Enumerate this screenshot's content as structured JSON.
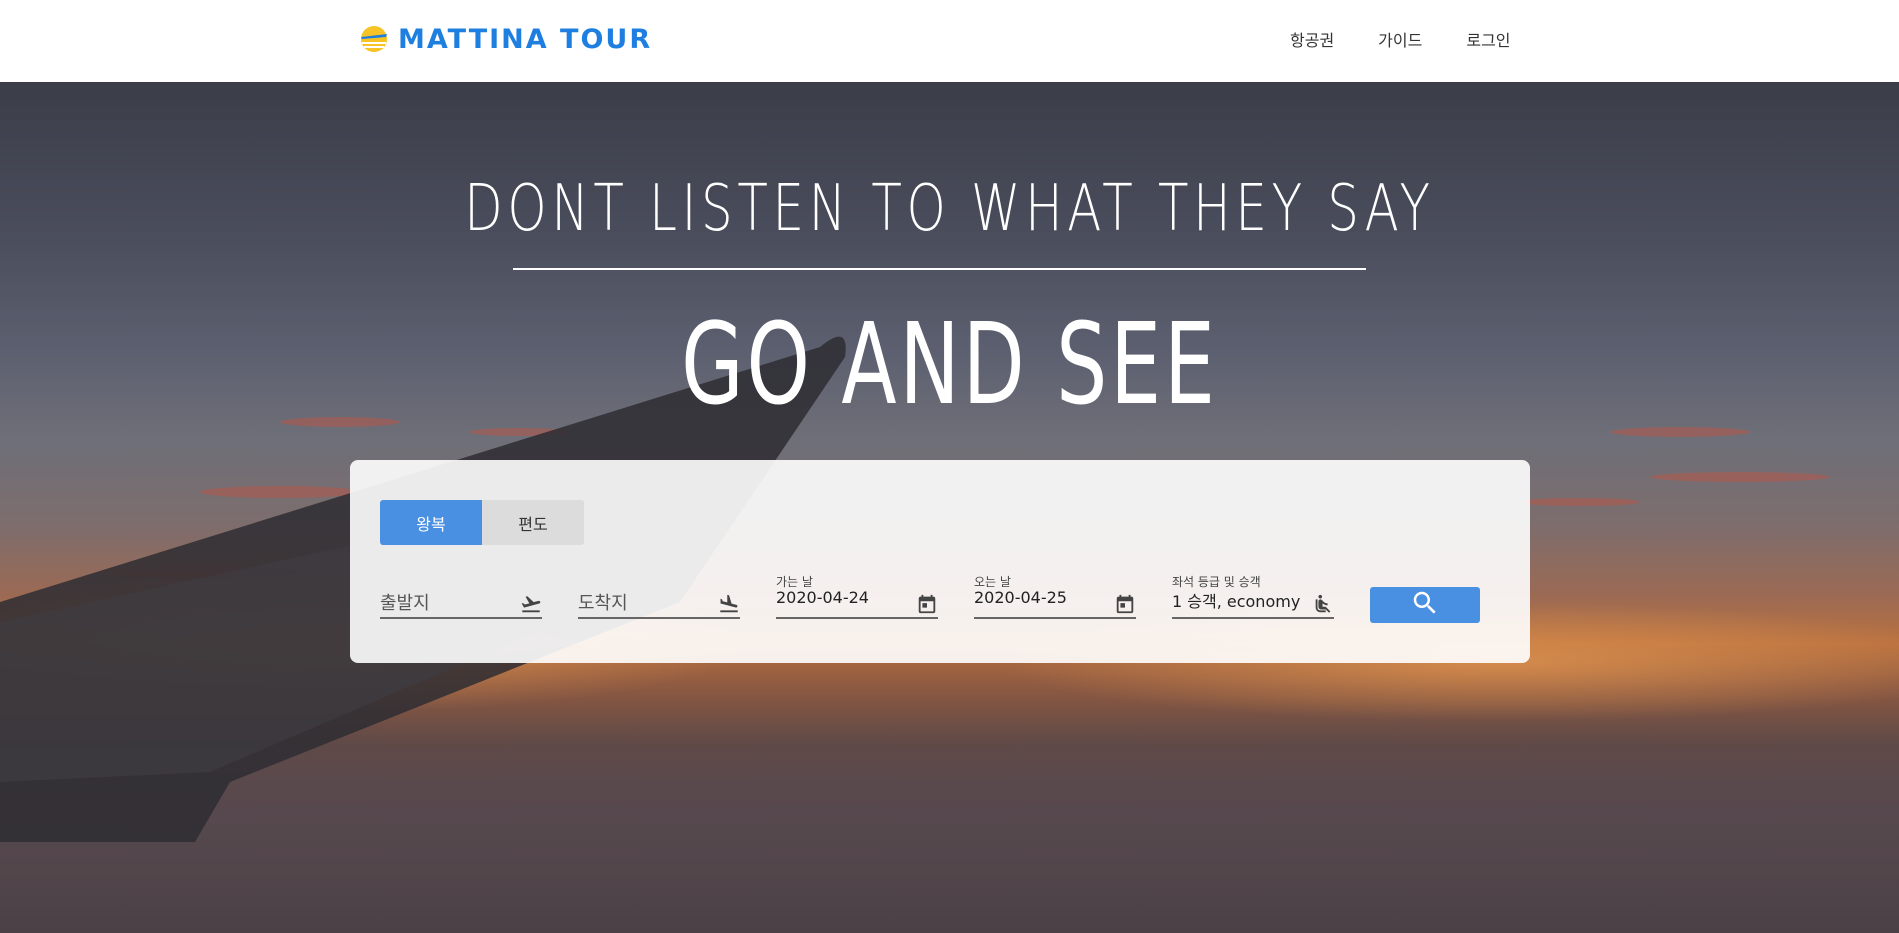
{
  "header": {
    "brand": "MATTINA TOUR",
    "nav": [
      "항공권",
      "가이드",
      "로그인"
    ]
  },
  "hero": {
    "tagline_top": "DONT LISTEN TO WHAT THEY SAY",
    "tagline_main": "GO AND SEE"
  },
  "search": {
    "trip_types": [
      "왕복",
      "편도"
    ],
    "selected_trip": "왕복",
    "origin_placeholder": "출발지",
    "destination_placeholder": "도착지",
    "departure_label": "가는 날",
    "departure_value": "2020-04-24",
    "return_label": "오는 날",
    "return_value": "2020-04-25",
    "seat_label": "좌석 등급 및 승객",
    "seat_value": "1 승객, economy"
  },
  "colors": {
    "brand": "#1e7fe0",
    "accent": "#4a90e2",
    "logo_sun": "#f7c325"
  },
  "icons": {
    "origin": "flight-takeoff-icon",
    "destination": "flight-land-icon",
    "date": "calendar-icon",
    "seat": "seat-icon",
    "search": "search-icon"
  }
}
